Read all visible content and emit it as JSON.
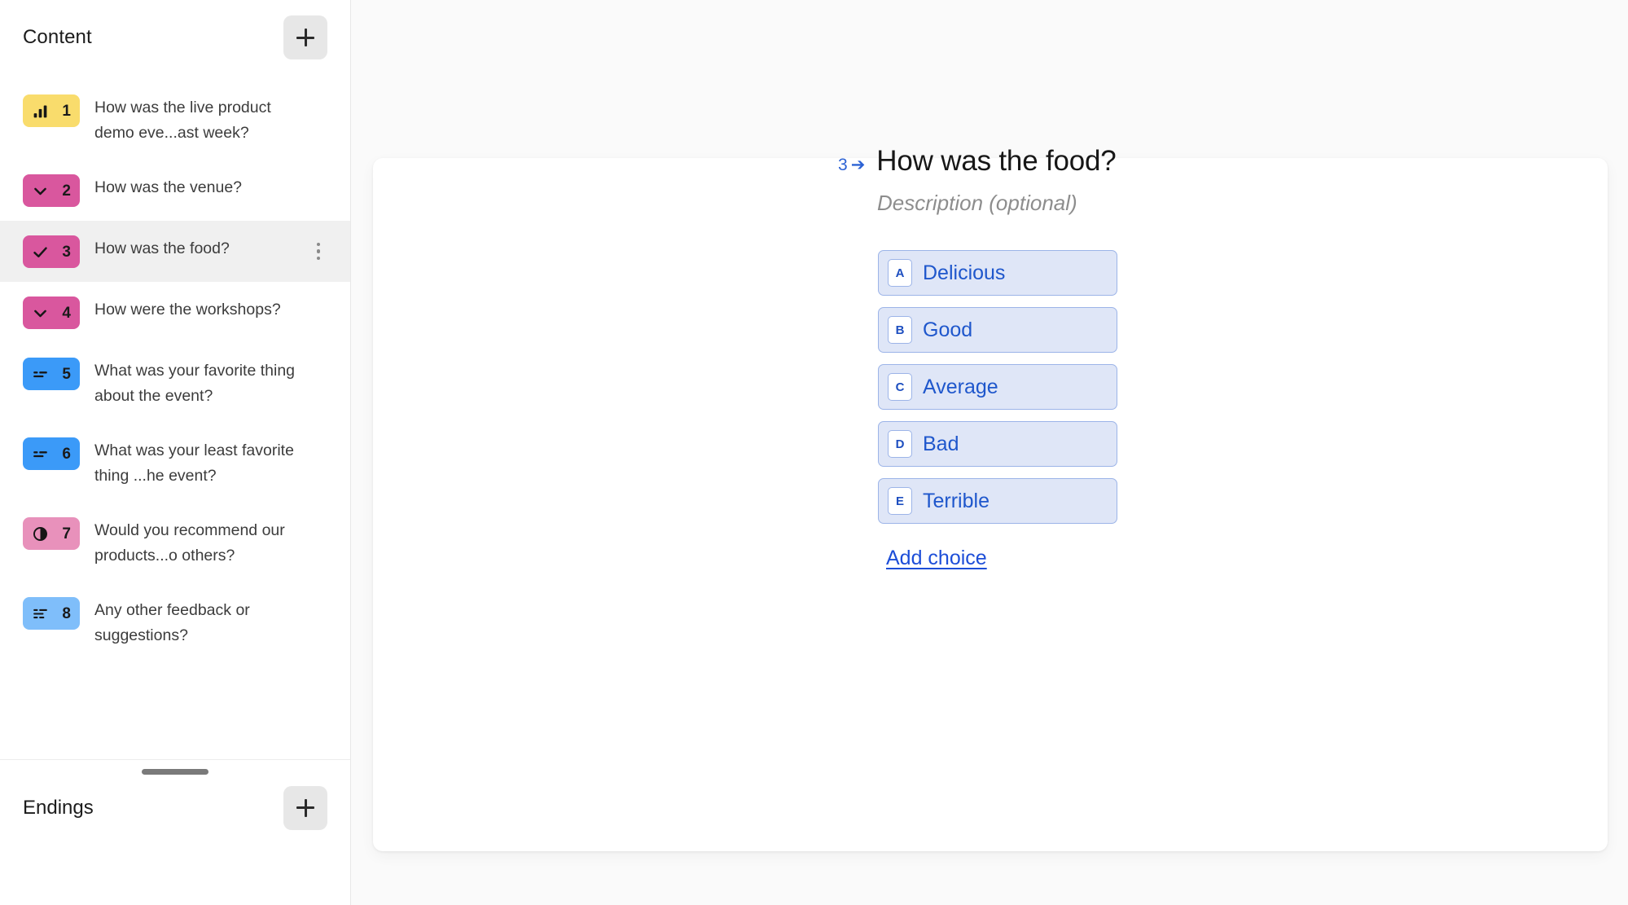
{
  "sidebar": {
    "content_header": {
      "title": "Content",
      "add_label": "+",
      "add_icon": "plus-icon"
    },
    "items": [
      {
        "number": "1",
        "label": "How was the live product demo eve...ast week?",
        "icon": "bar-chart-icon",
        "color": "#F9DC6C",
        "selected": false
      },
      {
        "number": "2",
        "label": "How was the venue?",
        "icon": "chevron-down-icon",
        "color": "#D9579E",
        "selected": false
      },
      {
        "number": "3",
        "label": "How was the food?",
        "icon": "check-icon",
        "color": "#D9579E",
        "selected": true
      },
      {
        "number": "4",
        "label": "How were the workshops?",
        "icon": "chevron-down-icon",
        "color": "#D9579E",
        "selected": false
      },
      {
        "number": "5",
        "label": "What was your favorite thing about the event?",
        "icon": "short-text-icon",
        "color": "#3B9AF8",
        "selected": false
      },
      {
        "number": "6",
        "label": "What was your least favorite thing ...he event?",
        "icon": "short-text-icon",
        "color": "#3B9AF8",
        "selected": false
      },
      {
        "number": "7",
        "label": "Would you recommend our products...o others?",
        "icon": "contrast-circle-icon",
        "color": "#E891BB",
        "selected": false
      },
      {
        "number": "8",
        "label": "Any other feedback or suggestions?",
        "icon": "long-text-icon",
        "color": "#7FBEFA",
        "selected": false
      }
    ],
    "item_menu_icon": "more-vertical-icon",
    "endings_header": {
      "title": "Endings",
      "add_label": "+",
      "add_icon": "plus-icon"
    },
    "resize_handle_icon": "drag-handle-icon"
  },
  "main": {
    "question": {
      "number": "3",
      "arrow_glyph": "➔",
      "title": "How was the food?",
      "description_placeholder": "Description (optional)"
    },
    "choices": [
      {
        "key": "A",
        "text": "Delicious"
      },
      {
        "key": "B",
        "text": "Good"
      },
      {
        "key": "C",
        "text": "Average"
      },
      {
        "key": "D",
        "text": "Bad"
      },
      {
        "key": "E",
        "text": "Terrible"
      }
    ],
    "add_choice_label": "Add choice"
  },
  "colors": {
    "link": "#1d4ed8",
    "choice_fill": "#dfe6f7",
    "choice_border": "#9cb4e8",
    "selected_row": "#f0f0f0",
    "canvas_bg": "#fafafa"
  }
}
